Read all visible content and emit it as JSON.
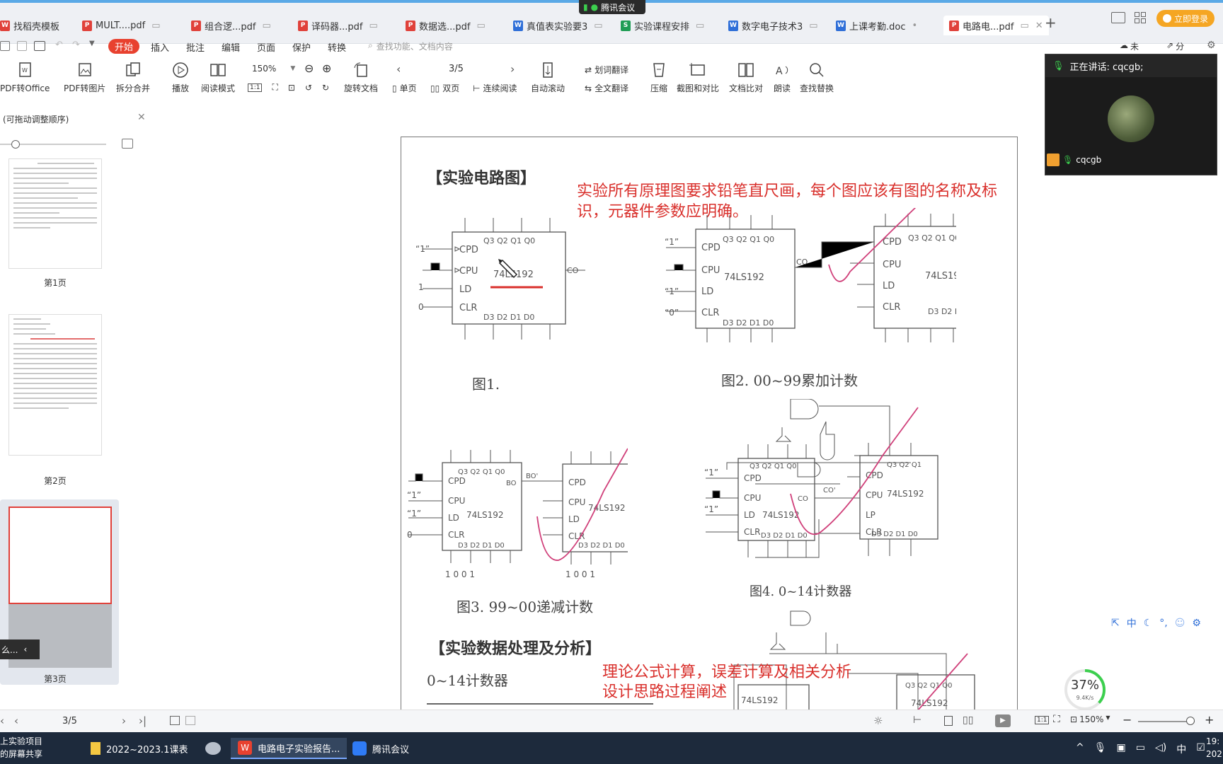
{
  "meeting_badge": "腾讯会议",
  "tabs": [
    {
      "label": "找稻壳模板",
      "type": "wps"
    },
    {
      "label": "MULT....pdf",
      "type": "pdf"
    },
    {
      "label": "组合逻...pdf",
      "type": "pdf"
    },
    {
      "label": "译码器...pdf",
      "type": "pdf"
    },
    {
      "label": "数据选...pdf",
      "type": "pdf"
    },
    {
      "label": "真值表实验要3",
      "type": "doc"
    },
    {
      "label": "实验课程安排",
      "type": "xls"
    },
    {
      "label": "数字电子技术3",
      "type": "doc"
    },
    {
      "label": "上课考勤.doc",
      "type": "doc"
    },
    {
      "label": "电路电...pdf",
      "type": "pdf"
    }
  ],
  "login_button": "立即登录",
  "menu": {
    "start": "开始",
    "insert": "插入",
    "annotate": "批注",
    "edit": "编辑",
    "page": "页面",
    "protect": "保护",
    "convert": "转换",
    "search_placeholder": "查找功能、文档内容",
    "unsync": "未同步",
    "share": "分享"
  },
  "toolbar": {
    "pdf2office": "PDF转Office",
    "pdf2img": "PDF转图片",
    "split": "拆分合并",
    "play": "播放",
    "read": "阅读模式",
    "zoom": "150%",
    "page_indicator": "3/5",
    "rotate": "旋转文档",
    "single": "单页",
    "double": "双页",
    "continuous": "连续阅读",
    "autoscroll": "自动滚动",
    "word_translate": "划词翻译",
    "full_translate": "全文翻译",
    "compress": "压缩",
    "screenshot": "截图和对比",
    "compare": "文档比对",
    "read_aloud": "朗读",
    "find_replace": "查找替换"
  },
  "sidebar": {
    "hint": "(可拖动调整顺序)",
    "pages": [
      "第1页",
      "第2页",
      "第3页"
    ],
    "collapsed": "么..."
  },
  "doc": {
    "section1": "【实验电路图】",
    "note1": "实验所有原理图要求铅笔直尺画，每个图应该有图的名称及标识，元器件参数应明确。",
    "chip": "74LS192",
    "fig1": "图1.",
    "fig2": "图2. 00~99累加计数",
    "fig3": "图3. 99~00递减计数",
    "fig4": "图4. 0~14计数器",
    "section2": "【实验数据处理及分析】",
    "counter": "0~14计数器",
    "note2a": "理论公式计算，误差计算及相关分析",
    "note2b": "设计思路过程阐述"
  },
  "meeting": {
    "speaking": "正在讲话: cqcgb;",
    "user": "cqcgb"
  },
  "ime": {
    "lang": "中"
  },
  "gauge": {
    "percent": "37%",
    "speed": "9.4K/s",
    "value": 0.37
  },
  "status": {
    "page": "3/5",
    "zoom": "150%"
  },
  "taskbar": {
    "item0": "上实验项目",
    "item0b": "的屏幕共享",
    "item1": "2022~2023.1课表",
    "item2": "电路电子实验报告...",
    "item3": "腾讯会议",
    "ime": "中",
    "time": "19:",
    "year": "202"
  },
  "colors": {
    "accent": "#e8412f",
    "red_text": "#d9302c",
    "login": "#f5a623"
  }
}
